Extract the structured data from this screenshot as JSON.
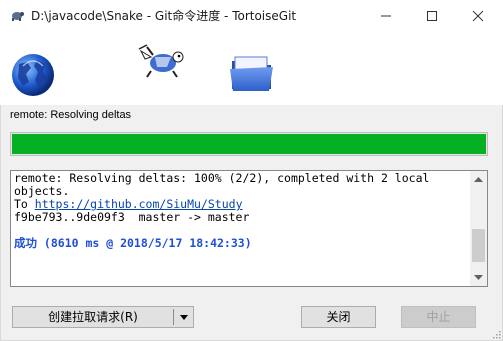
{
  "window": {
    "title": "D:\\javacode\\Snake - Git命令进度 - TortoiseGit",
    "controls": [
      "minimize",
      "maximize",
      "close"
    ]
  },
  "banner": {
    "icons": [
      "globe-icon",
      "tortoise-icon",
      "folder-icon"
    ]
  },
  "status": {
    "text": "remote: Resolving deltas"
  },
  "progress": {
    "value": 1.0,
    "color": "#06b025"
  },
  "log": {
    "line1": "remote: Resolving deltas: 100% (2/2), completed with 2 local",
    "line2": "objects.",
    "line3_prefix": "To ",
    "line3_link": "https://github.com/SiuMu/Study",
    "line4": "f9be793..9de09f3  master -> master",
    "result": "成功 (8610 ms @ 2018/5/17 18:42:33)"
  },
  "buttons": {
    "create_pull_request": "创建拉取请求(R)",
    "close": "关闭",
    "abort": "中止"
  },
  "colors": {
    "link": "#0645ad",
    "success": "#1f4fd6"
  }
}
